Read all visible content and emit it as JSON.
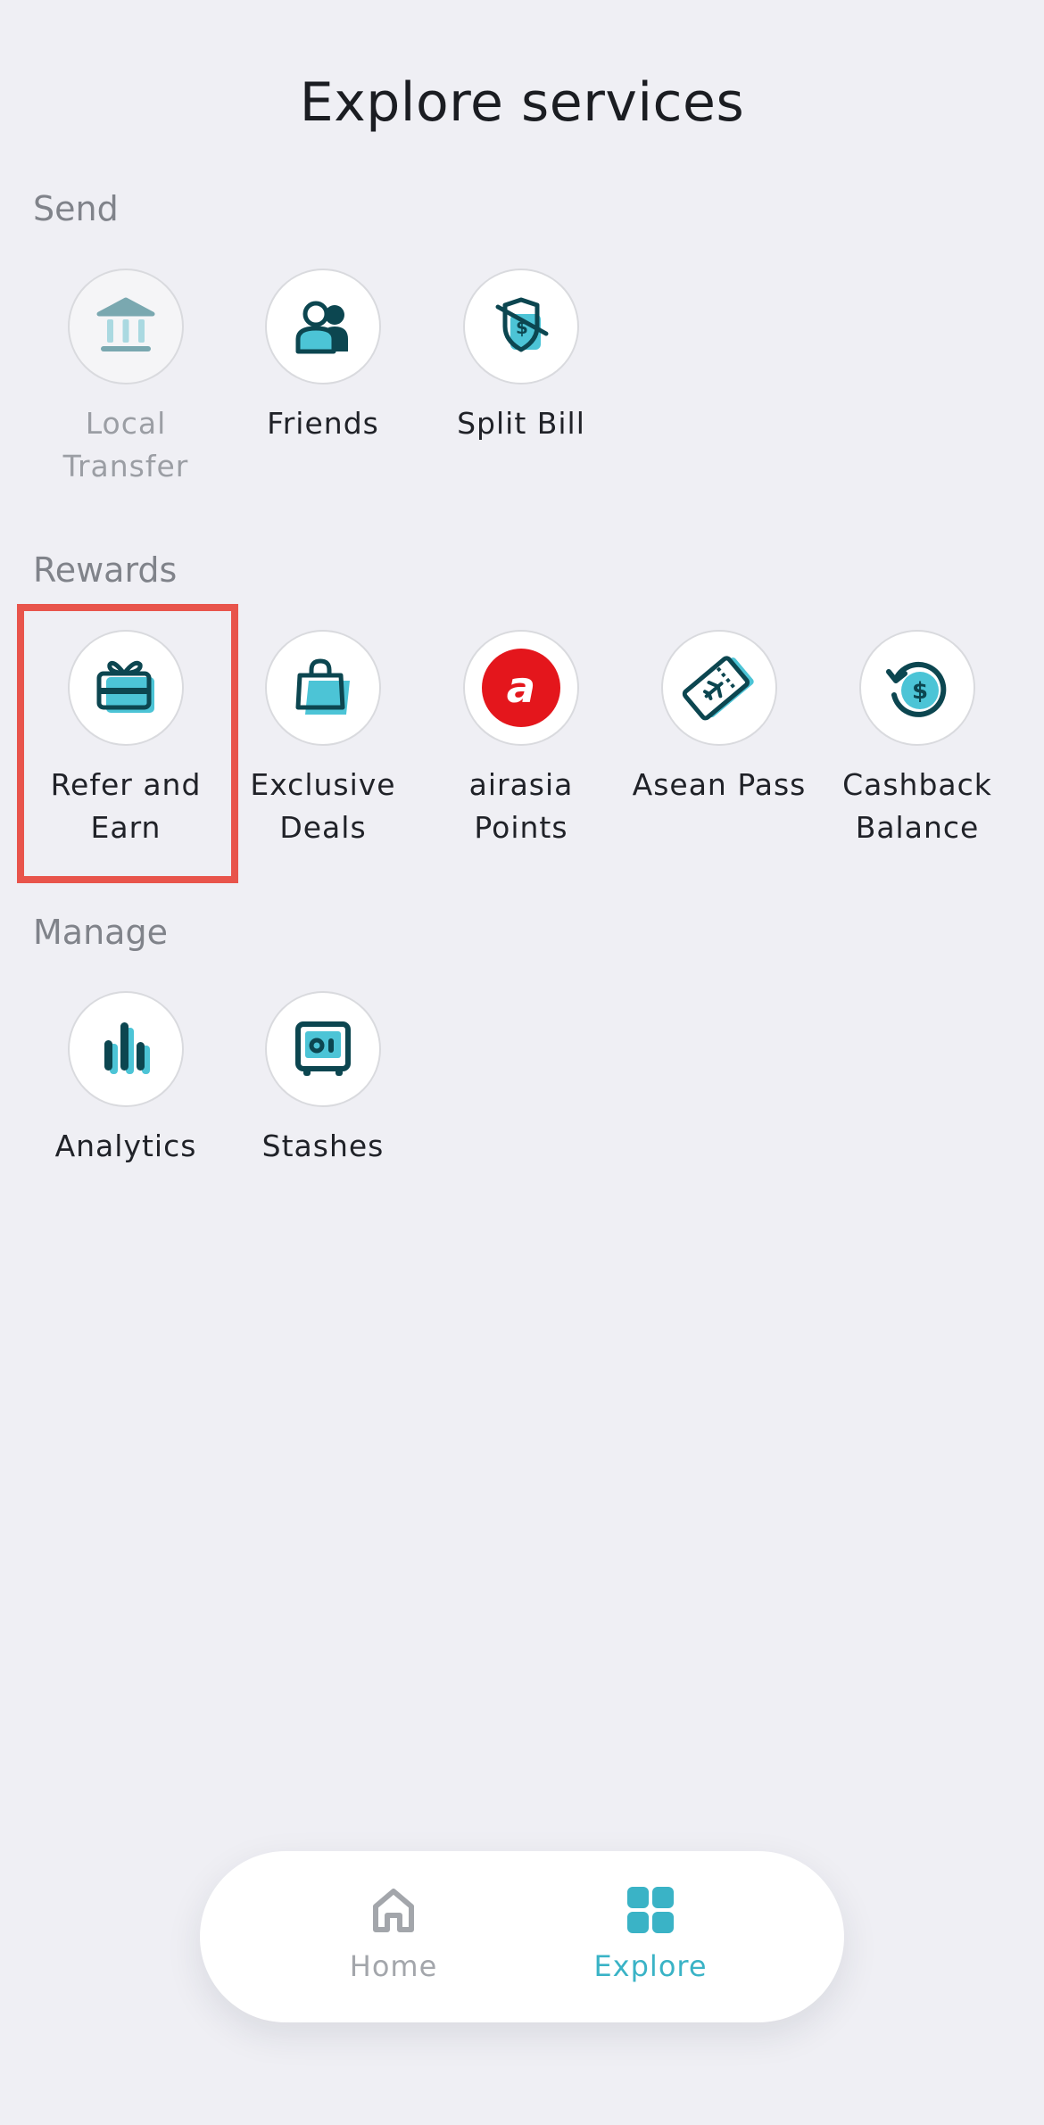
{
  "header": {
    "title": "Explore services"
  },
  "sections": {
    "send": {
      "title": "Send",
      "items": {
        "local_transfer": {
          "line1": "Local",
          "line2": "Transfer"
        },
        "friends": {
          "line1": "Friends",
          "line2": ""
        },
        "split_bill": {
          "line1": "Split Bill",
          "line2": ""
        }
      }
    },
    "rewards": {
      "title": "Rewards",
      "items": {
        "refer_earn": {
          "line1": "Refer and",
          "line2": "Earn"
        },
        "exclusive_deals": {
          "line1": "Exclusive",
          "line2": "Deals"
        },
        "airasia_points": {
          "line1": "airasia",
          "line2": "Points"
        },
        "asean_pass": {
          "line1": "Asean Pass",
          "line2": ""
        },
        "cashback_balance": {
          "line1": "Cashback",
          "line2": "Balance"
        }
      }
    },
    "manage": {
      "title": "Manage",
      "items": {
        "analytics": {
          "line1": "Analytics",
          "line2": ""
        },
        "stashes": {
          "line1": "Stashes",
          "line2": ""
        }
      }
    }
  },
  "bottom_nav": {
    "home": {
      "label": "Home",
      "icon": "home-icon"
    },
    "explore": {
      "label": "Explore",
      "icon": "grid-icon",
      "active": true
    }
  },
  "icons": {
    "local_transfer": "bank-icon",
    "friends": "friends-icon",
    "split_bill": "split-bill-icon",
    "refer_earn": "gift-card-icon",
    "exclusive_deals": "shopping-bag-icon",
    "airasia_points": "airasia-logo-icon",
    "asean_pass": "ticket-plane-icon",
    "cashback_balance": "cashback-icon",
    "analytics": "bar-chart-icon",
    "stashes": "safe-icon"
  },
  "colors": {
    "background": "#efeff4",
    "dark_teal": "#0c4650",
    "accent_cyan": "#4cc4d6",
    "airasia_red": "#e4161c",
    "highlight_red": "#e8544b",
    "nav_active": "#3ab3c6",
    "nav_inactive": "#a3a6ab"
  }
}
